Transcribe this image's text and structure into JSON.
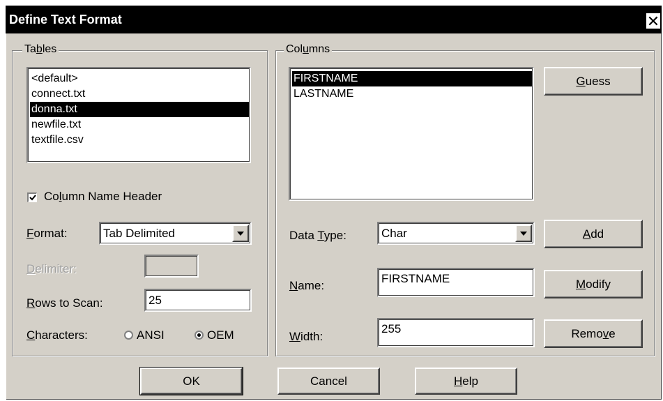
{
  "window": {
    "title": "Define Text Format",
    "close_glyph": "✕"
  },
  "tables": {
    "group_label_prefix": "Ta",
    "group_label_mnemonic": "b",
    "group_label_suffix": "les",
    "items": [
      "<default>",
      "connect.txt",
      "donna.txt",
      "newfile.txt",
      "textfile.csv"
    ],
    "selected_index": 2,
    "column_name_header": {
      "label_prefix": "Co",
      "label_mnemonic": "l",
      "label_suffix": "umn Name Header",
      "checked": true
    },
    "format": {
      "label_mnemonic": "F",
      "label_suffix": "ormat:",
      "value": "Tab Delimited"
    },
    "delimiter": {
      "label_mnemonic": "D",
      "label_suffix": "elimiter:",
      "value": "",
      "enabled": false
    },
    "rows_to_scan": {
      "label_mnemonic": "R",
      "label_suffix": "ows to Scan:",
      "value": "25"
    },
    "characters": {
      "label_mnemonic": "C",
      "label_suffix": "haracters:",
      "options": [
        "ANSI",
        "OEM"
      ],
      "selected": "OEM"
    }
  },
  "columns": {
    "group_label_prefix": "Col",
    "group_label_mnemonic": "u",
    "group_label_suffix": "mns",
    "items": [
      "FIRSTNAME",
      "LASTNAME"
    ],
    "selected_index": 0,
    "data_type": {
      "label_prefix": "Data ",
      "label_mnemonic": "T",
      "label_suffix": "ype:",
      "value": "Char"
    },
    "name": {
      "label_mnemonic": "N",
      "label_suffix": "ame:",
      "value": "FIRSTNAME"
    },
    "width": {
      "label_mnemonic": "W",
      "label_suffix": "idth:",
      "value": "255"
    },
    "buttons": {
      "guess": {
        "mnemonic": "G",
        "suffix": "uess"
      },
      "add": {
        "mnemonic": "A",
        "suffix": "dd"
      },
      "modify": {
        "mnemonic": "M",
        "suffix": "odify"
      },
      "remove": {
        "prefix": "Remo",
        "mnemonic": "v",
        "suffix": "e"
      }
    }
  },
  "footer": {
    "ok_label": "OK",
    "cancel_label": "Cancel",
    "help_mnemonic": "H",
    "help_suffix": "elp"
  }
}
